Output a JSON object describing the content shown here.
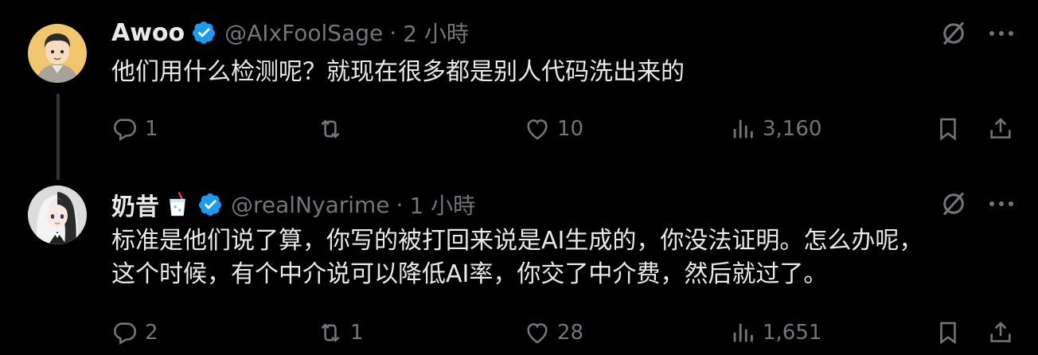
{
  "tweets": [
    {
      "name": "Awoo",
      "handle": "@AIxFoolSage",
      "separator": "·",
      "time": "2 小時",
      "text": "他们用什么检测呢？就现在很多都是别人代码洗出来的",
      "replies": "1",
      "retweets": "",
      "likes": "10",
      "views": "3,160",
      "avatar_icon": "cartoon-man-avatar"
    },
    {
      "name": "奶昔",
      "name_emoji": "milkshake-emoji",
      "handle": "@realNyarime",
      "separator": "·",
      "time": "1 小時",
      "text_line1": "标准是他们说了算，你写的被打回来说是AI生成的，你没法证明。怎么办呢，",
      "text_line2": "这个时候，有个中介说可以降低AI率，你交了中介费，然后就过了。",
      "replies": "2",
      "retweets": "1",
      "likes": "28",
      "views": "1,651",
      "avatar_icon": "anime-girl-avatar"
    }
  ],
  "colors": {
    "background": "#000000",
    "text": "#e7e9ea",
    "muted": "#71767b",
    "verified": "#1d9bf0",
    "thread_line": "#333639"
  }
}
